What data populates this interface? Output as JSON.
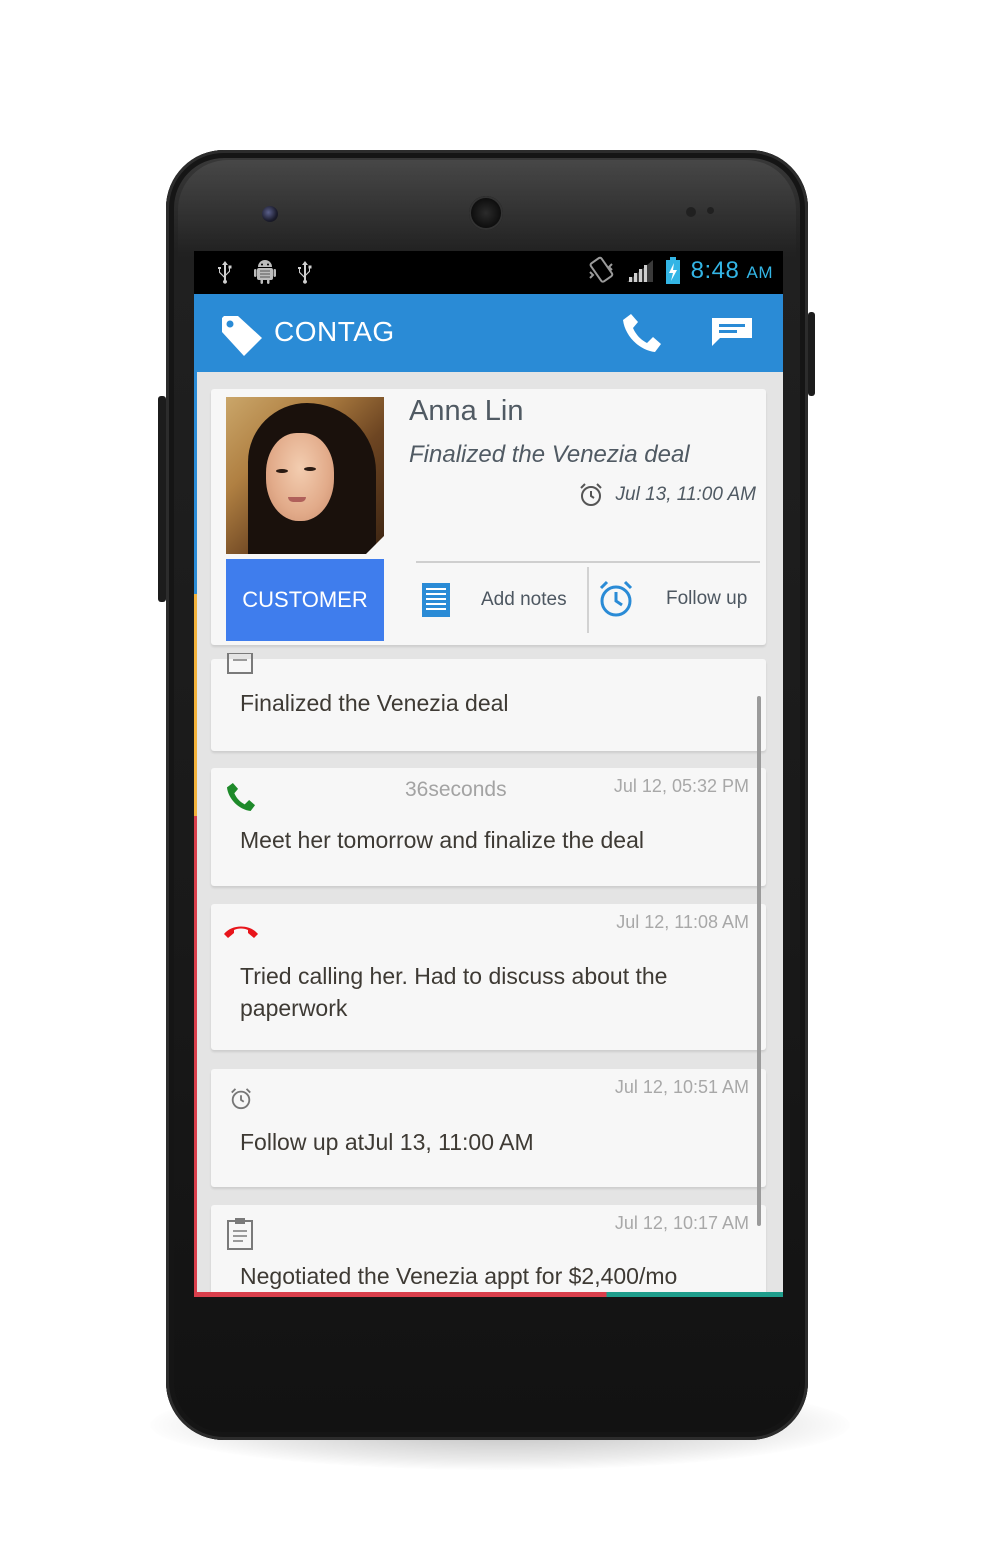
{
  "status_bar": {
    "time": "8:48",
    "ampm": "AM",
    "left_icons": [
      "usb-icon",
      "android-debug-icon",
      "usb-icon"
    ],
    "right_icons": [
      "vibrate-icon",
      "signal-icon",
      "battery-charging-icon"
    ]
  },
  "app_bar": {
    "title": "CONTAG",
    "logo_icon": "tag-icon",
    "actions": [
      "phone-icon",
      "message-icon"
    ]
  },
  "profile": {
    "name": "Anna Lin",
    "subtitle": "Finalized the Venezia deal",
    "due": "Jul 13, 11:00 AM",
    "badge": "CUSTOMER",
    "add_notes": "Add notes",
    "follow_up": "Follow up"
  },
  "timeline": [
    {
      "type": "note",
      "icon": "notepad-icon",
      "time": "",
      "duration": "",
      "text": "Finalized the Venezia deal"
    },
    {
      "type": "call",
      "icon": "phone-call-icon",
      "time": "Jul 12, 05:32 PM",
      "duration": "36seconds",
      "text": "Meet her tomorrow and finalize the deal"
    },
    {
      "type": "missed",
      "icon": "hang-up-icon",
      "time": "Jul 12, 11:08 AM",
      "duration": "",
      "text": "Tried calling her. Had to discuss about the paperwork"
    },
    {
      "type": "followup",
      "icon": "alarm-icon",
      "time": "Jul 12, 10:51 AM",
      "duration": "",
      "text": "Follow up atJul 13, 11:00 AM"
    },
    {
      "type": "note",
      "icon": "clipboard-icon",
      "time": "Jul 12, 10:17 AM",
      "duration": "",
      "text": "Negotiated the Venezia appt for $2,400/mo"
    }
  ],
  "colors": {
    "app_bar": "#2a8bd6",
    "customer_badge": "#3f7ded",
    "call_green": "#1e8a2a",
    "missed_red": "#e8151b",
    "status_blue": "#33b5e5"
  }
}
